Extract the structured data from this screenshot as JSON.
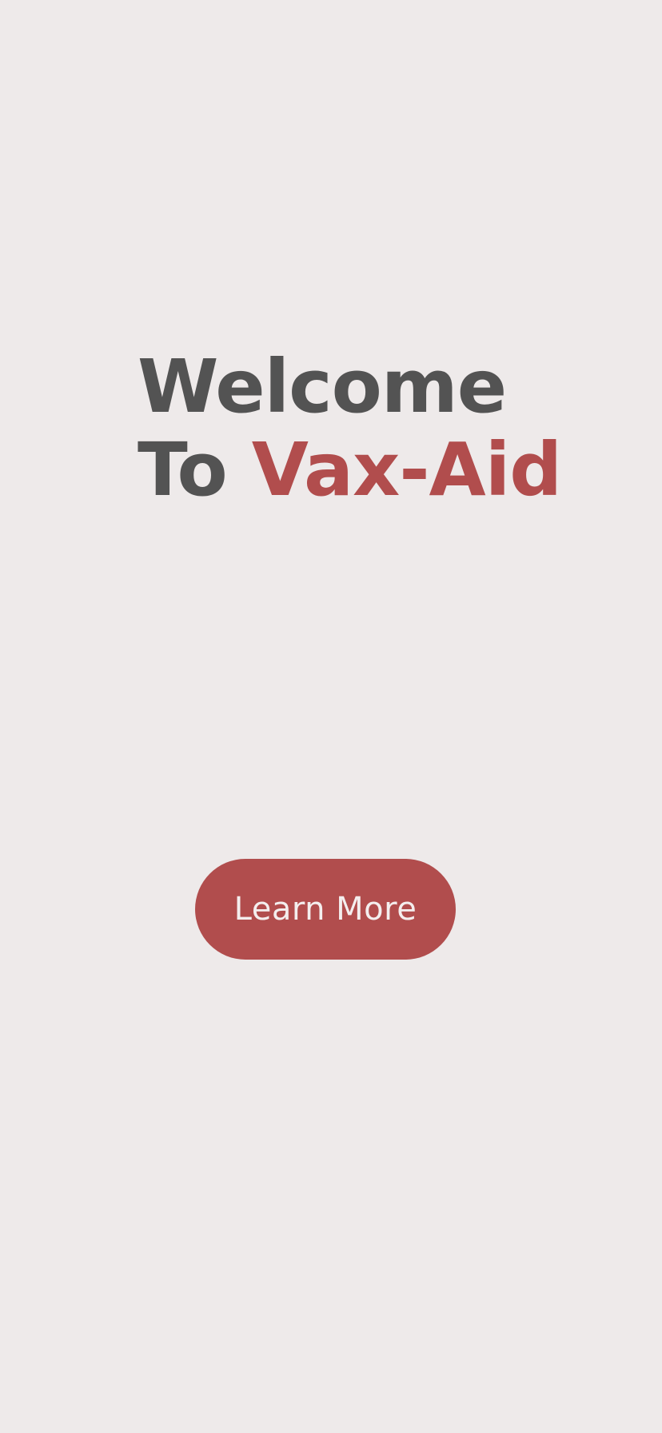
{
  "headline": {
    "line1": "Welcome",
    "line2_prefix": "To",
    "brand": "Vax-Aid"
  },
  "cta": {
    "label": "Learn More"
  },
  "colors": {
    "background": "#EEEAEA",
    "text_dark": "#535353",
    "accent": "#B14D4D",
    "button_text": "#F4EEEE"
  }
}
